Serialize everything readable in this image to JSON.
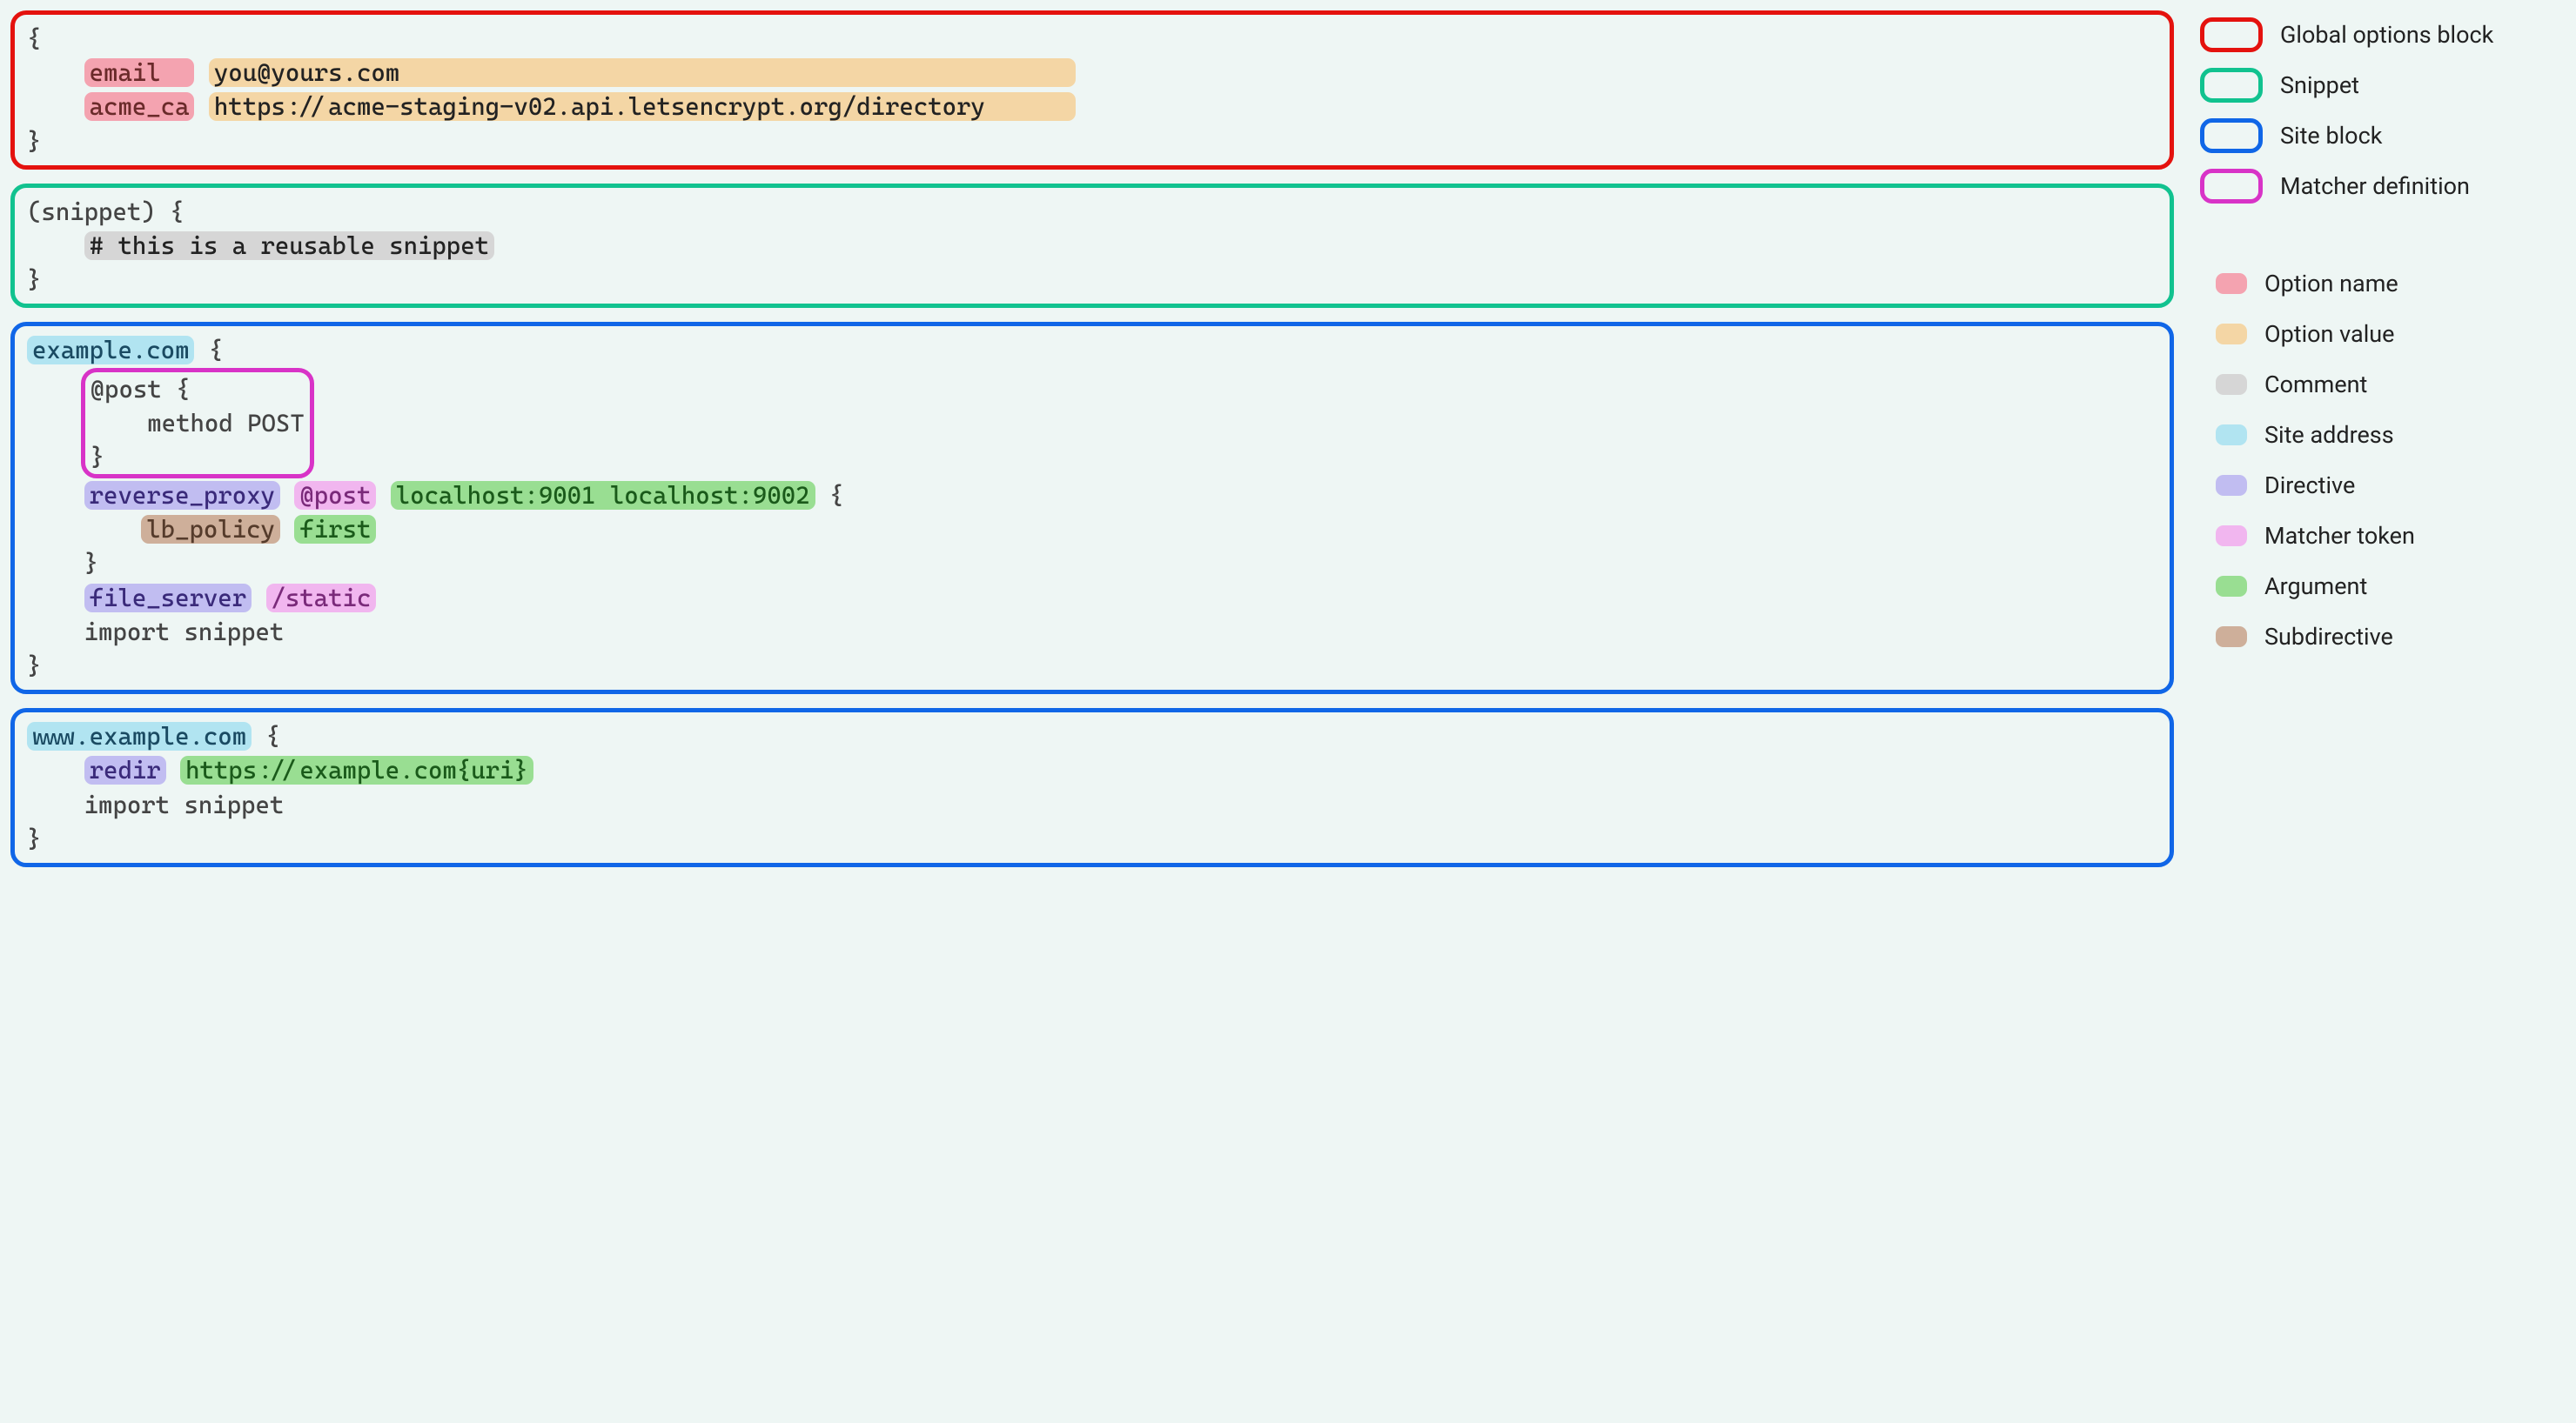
{
  "colors": {
    "global": "#e4120e",
    "snippet": "#11c28f",
    "site": "#1066e7",
    "matcher": "#d833c7",
    "optname": "#f4a3b0",
    "optval": "#f4d6a5",
    "comment": "#d6d6d6",
    "siteaddr": "#b1e4f1",
    "directive": "#c1bdf1",
    "matchertok": "#f1b6ef",
    "arg": "#99de92",
    "subdir": "#ceaf9a"
  },
  "global": {
    "open": "{",
    "opt1_name": "email  ",
    "opt1_val": "you@yours.com                                               ",
    "opt2_name": "acme_ca",
    "opt2_val": "https://acme-staging-v02.api.letsencrypt.org/directory      ",
    "close": "}"
  },
  "snippet": {
    "head": "(snippet) {",
    "comment": "# this is a reusable snippet",
    "close": "}"
  },
  "site1": {
    "addr": "example.com",
    "open": " {",
    "m_open": "@post {",
    "m_body": "    method POST",
    "m_close": "}",
    "rp_dir": "reverse_proxy",
    "rp_match": "@post",
    "rp_args": "localhost:9001 localhost:9002",
    "rp_brace": " {",
    "lb_sub": "lb_policy",
    "lb_arg": "first",
    "rp_close": "    }",
    "fs_dir": "file_server",
    "fs_match": "/static",
    "imp": "    import snippet",
    "close": "}"
  },
  "site2": {
    "addr": "www.example.com",
    "open": " {",
    "redir_dir": "redir",
    "redir_arg": "https://example.com{uri}",
    "imp": "    import snippet",
    "close": "}"
  },
  "legend": {
    "boxes": [
      {
        "label": "Global options block",
        "color": "global"
      },
      {
        "label": "Snippet",
        "color": "snippet"
      },
      {
        "label": "Site block",
        "color": "site"
      },
      {
        "label": "Matcher definition",
        "color": "matcher"
      }
    ],
    "swatches": [
      {
        "label": "Option name",
        "color": "optname"
      },
      {
        "label": "Option value",
        "color": "optval"
      },
      {
        "label": "Comment",
        "color": "comment"
      },
      {
        "label": "Site address",
        "color": "siteaddr"
      },
      {
        "label": "Directive",
        "color": "directive"
      },
      {
        "label": "Matcher token",
        "color": "matchertok"
      },
      {
        "label": "Argument",
        "color": "arg"
      },
      {
        "label": "Subdirective",
        "color": "subdir"
      }
    ]
  }
}
